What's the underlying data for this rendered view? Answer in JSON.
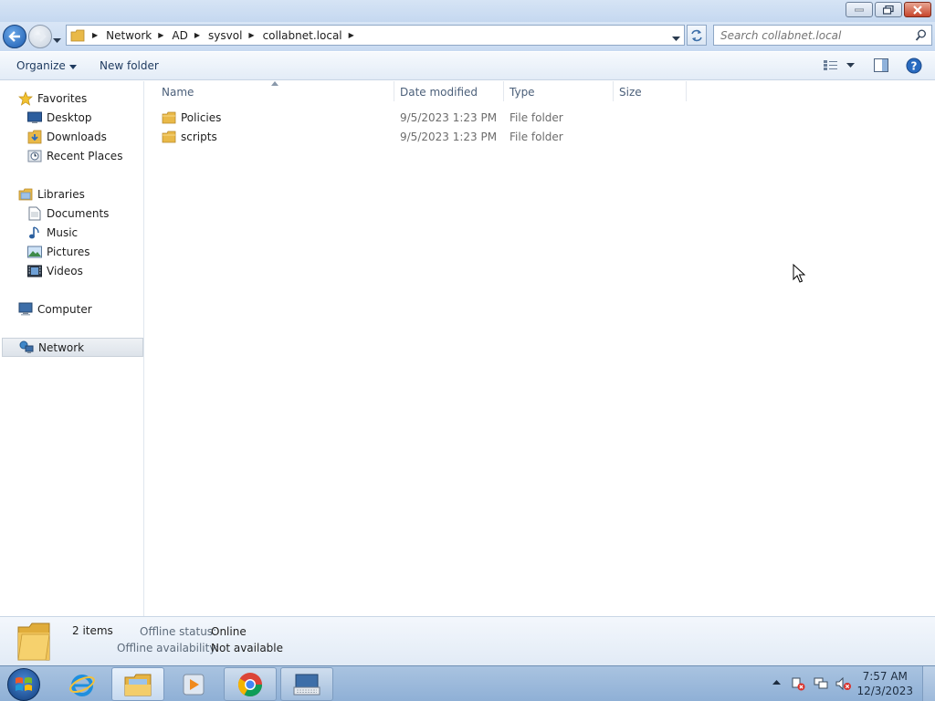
{
  "address": {
    "breadcrumbs": [
      "Network",
      "AD",
      "sysvol",
      "collabnet.local"
    ],
    "search_placeholder": "Search collabnet.local"
  },
  "toolbar": {
    "organize_label": "Organize",
    "new_folder_label": "New folder"
  },
  "nav": {
    "favorites": "Favorites",
    "favorites_items": [
      "Desktop",
      "Downloads",
      "Recent Places"
    ],
    "libraries": "Libraries",
    "libraries_items": [
      "Documents",
      "Music",
      "Pictures",
      "Videos"
    ],
    "computer": "Computer",
    "network": "Network"
  },
  "columns": [
    "Name",
    "Date modified",
    "Type",
    "Size"
  ],
  "files": [
    {
      "name": "Policies",
      "date": "9/5/2023 1:23 PM",
      "type": "File folder",
      "size": ""
    },
    {
      "name": "scripts",
      "date": "9/5/2023 1:23 PM",
      "type": "File folder",
      "size": ""
    }
  ],
  "details": {
    "count": "2 items",
    "offline_status_label": "Offline status:",
    "offline_status_value": "Online",
    "offline_availability_label": "Offline availability:",
    "offline_availability_value": "Not available"
  },
  "taskbar": {
    "time": "7:57 AM",
    "date": "12/3/2023"
  },
  "colors": {
    "accent": "#1c5cb0",
    "folder": "#e9b948"
  }
}
